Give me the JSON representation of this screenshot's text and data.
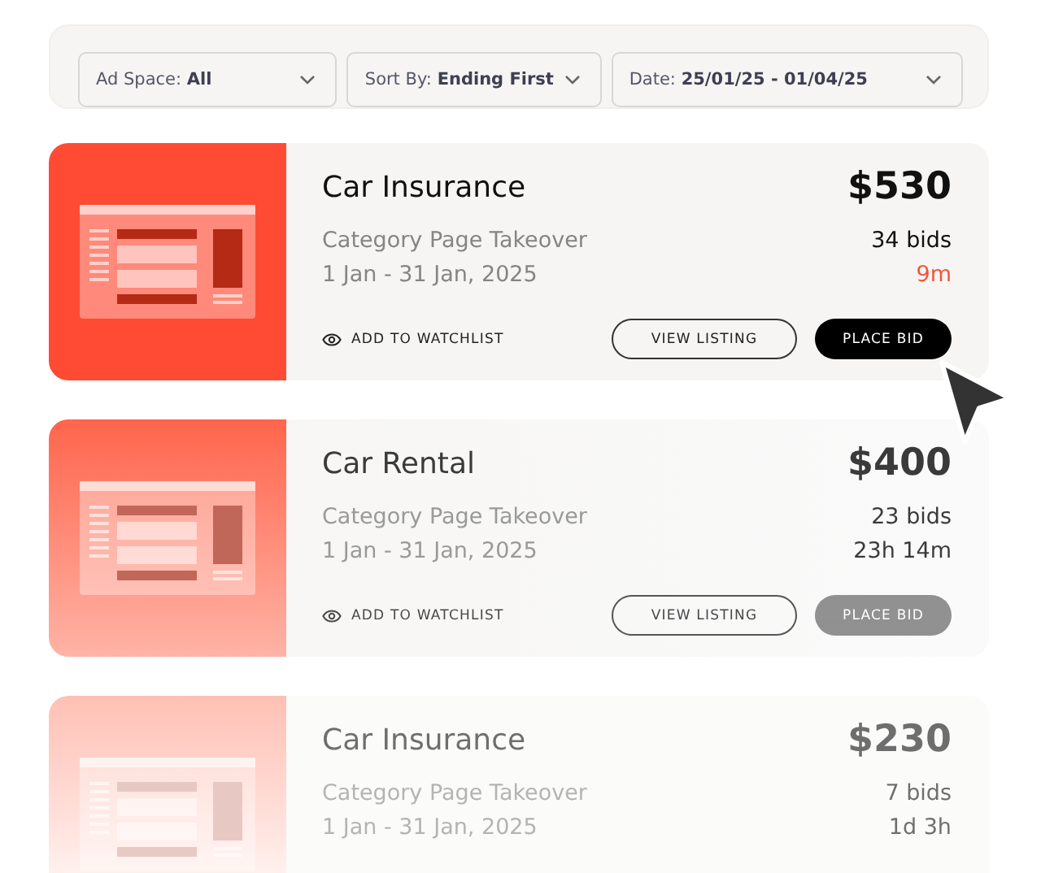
{
  "filters": [
    {
      "label": "Ad Space:",
      "value": "All"
    },
    {
      "label": "Sort By:",
      "value": "Ending First"
    },
    {
      "label": "Date:",
      "value": "25/01/25 - 01/04/25"
    }
  ],
  "listings": [
    {
      "kind": "active",
      "title": "Car Insurance",
      "price": "$530",
      "category": "Category Page Takeover",
      "dates": "1 Jan - 31 Jan, 2025",
      "bids": "34 bids",
      "time_left": "9m",
      "urgent": true,
      "watchlist": "ADD TO WATCHLIST",
      "view": "VIEW LISTING",
      "bid": "PLACE BID"
    },
    {
      "kind": "muted",
      "title": "Car Rental",
      "price": "$400",
      "category": "Category Page Takeover",
      "dates": "1 Jan - 31 Jan, 2025",
      "bids": "23 bids",
      "time_left": "23h 14m",
      "urgent": false,
      "watchlist": "ADD TO WATCHLIST",
      "view": "VIEW LISTING",
      "bid": "PLACE BID"
    },
    {
      "kind": "ghost",
      "title": "Car Insurance",
      "price": "$230",
      "category": "Category Page Takeover",
      "dates": "1 Jan - 31 Jan, 2025",
      "bids": "7 bids",
      "time_left": "1d 3h",
      "urgent": false
    }
  ]
}
